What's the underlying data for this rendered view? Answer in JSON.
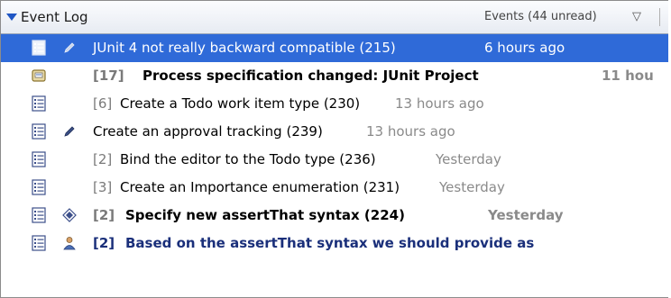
{
  "header": {
    "title": "Event Log",
    "events_summary": "Events (44 unread)",
    "filter_icon": "filter-triangle-icon"
  },
  "events": [
    {
      "prefix": "",
      "title": "JUnit 4 not really backward compatible (215)",
      "time": "6 hours ago",
      "icon": "work-item-icon",
      "marker": "pencil-gray-icon",
      "state": "selected"
    },
    {
      "prefix": "[17]",
      "title": "Process specification changed: JUnit Project",
      "time": "11 hou",
      "icon": "process-spec-icon",
      "marker": "",
      "state": "unread"
    },
    {
      "prefix": "[6]",
      "title": "Create a Todo work item type (230)",
      "time": "13 hours ago",
      "icon": "work-item-icon",
      "marker": "",
      "state": "read"
    },
    {
      "prefix": "",
      "title": "Create an approval tracking (239)",
      "time": "13 hours ago",
      "icon": "work-item-icon",
      "marker": "pencil-icon",
      "state": "read"
    },
    {
      "prefix": "[2]",
      "title": "Bind the editor to the Todo type (236)",
      "time": "Yesterday",
      "icon": "work-item-icon",
      "marker": "",
      "state": "read"
    },
    {
      "prefix": "[3]",
      "title": "Create an Importance enumeration (231)",
      "time": "Yesterday",
      "icon": "work-item-icon",
      "marker": "",
      "state": "read"
    },
    {
      "prefix": "[2]",
      "title": "Specify new assertThat syntax (224)",
      "time": "Yesterday",
      "icon": "work-item-icon",
      "marker": "diamond-icon",
      "state": "unread"
    },
    {
      "prefix": "[2]",
      "title": "Based on the assertThat syntax we should provide as",
      "time": "",
      "icon": "work-item-icon",
      "marker": "user-icon",
      "state": "unread-blue"
    }
  ],
  "colors": {
    "selection": "#2f6ad8",
    "time_gray": "#8a8a8a",
    "unread_blue": "#1a2f7a"
  }
}
